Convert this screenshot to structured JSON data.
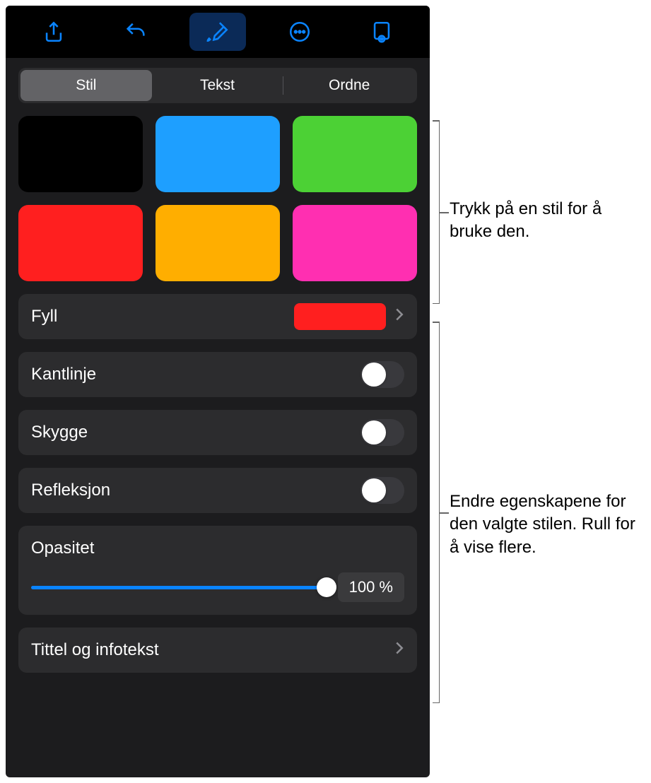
{
  "tabs": {
    "style": "Stil",
    "text": "Tekst",
    "arrange": "Ordne"
  },
  "swatches": [
    "#000000",
    "#1e9fff",
    "#4cd135",
    "#ff1f1f",
    "#ffae00",
    "#ff2fb1"
  ],
  "rows": {
    "fill": {
      "label": "Fyll",
      "color": "#ff1f1f"
    },
    "border": {
      "label": "Kantlinje"
    },
    "shadow": {
      "label": "Skygge"
    },
    "reflection": {
      "label": "Refleksjon"
    },
    "opacity": {
      "label": "Opasitet",
      "value": "100 %"
    },
    "title_caption": {
      "label": "Tittel og infotekst"
    }
  },
  "callouts": {
    "styles": "Trykk på en stil for å bruke den.",
    "properties": "Endre egenskapene for den valgte stilen. Rull for å vise flere."
  }
}
